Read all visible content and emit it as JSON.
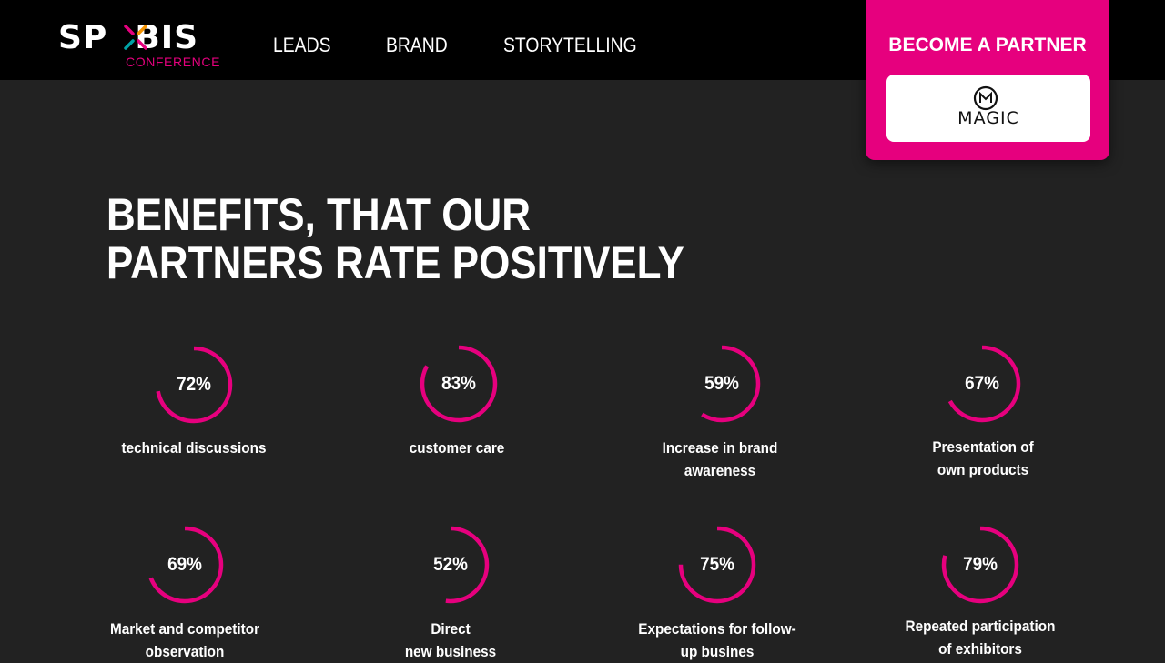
{
  "header": {
    "logo": {
      "name_left": "SP",
      "name_right": "BIS",
      "subtitle": "CONFERENCE"
    },
    "nav": [
      {
        "label": "LEADS"
      },
      {
        "label": "BRAND"
      },
      {
        "label": "STORYTELLING"
      }
    ],
    "partner": {
      "title": "BECOME A PARTNER",
      "sponsor_logo_text": "MAGIC"
    }
  },
  "main": {
    "heading_line1": "BENEFITS, THAT OUR",
    "heading_line2": "PARTNERS RATE POSITIVELY",
    "benefits": [
      {
        "percent": 72,
        "value_label": "72%",
        "label_line1": "technical discussions",
        "label_line2": ""
      },
      {
        "percent": 83,
        "value_label": "83%",
        "label_line1": "customer care",
        "label_line2": ""
      },
      {
        "percent": 59,
        "value_label": "59%",
        "label_line1": "Increase in brand",
        "label_line2": "awareness"
      },
      {
        "percent": 67,
        "value_label": "67%",
        "label_line1": "Presentation of",
        "label_line2": "own products"
      },
      {
        "percent": 69,
        "value_label": "69%",
        "label_line1": "Market and competitor",
        "label_line2": "observation"
      },
      {
        "percent": 52,
        "value_label": "52%",
        "label_line1": "Direct",
        "label_line2": "new business"
      },
      {
        "percent": 75,
        "value_label": "75%",
        "label_line1": "Expectations for follow-",
        "label_line2": "up busines"
      },
      {
        "percent": 79,
        "value_label": "79%",
        "label_line1": "Repeated participation",
        "label_line2": "of exhibitors"
      }
    ]
  },
  "colors": {
    "accent": "#e6007e",
    "background": "#222222",
    "header_bg": "#000000"
  }
}
